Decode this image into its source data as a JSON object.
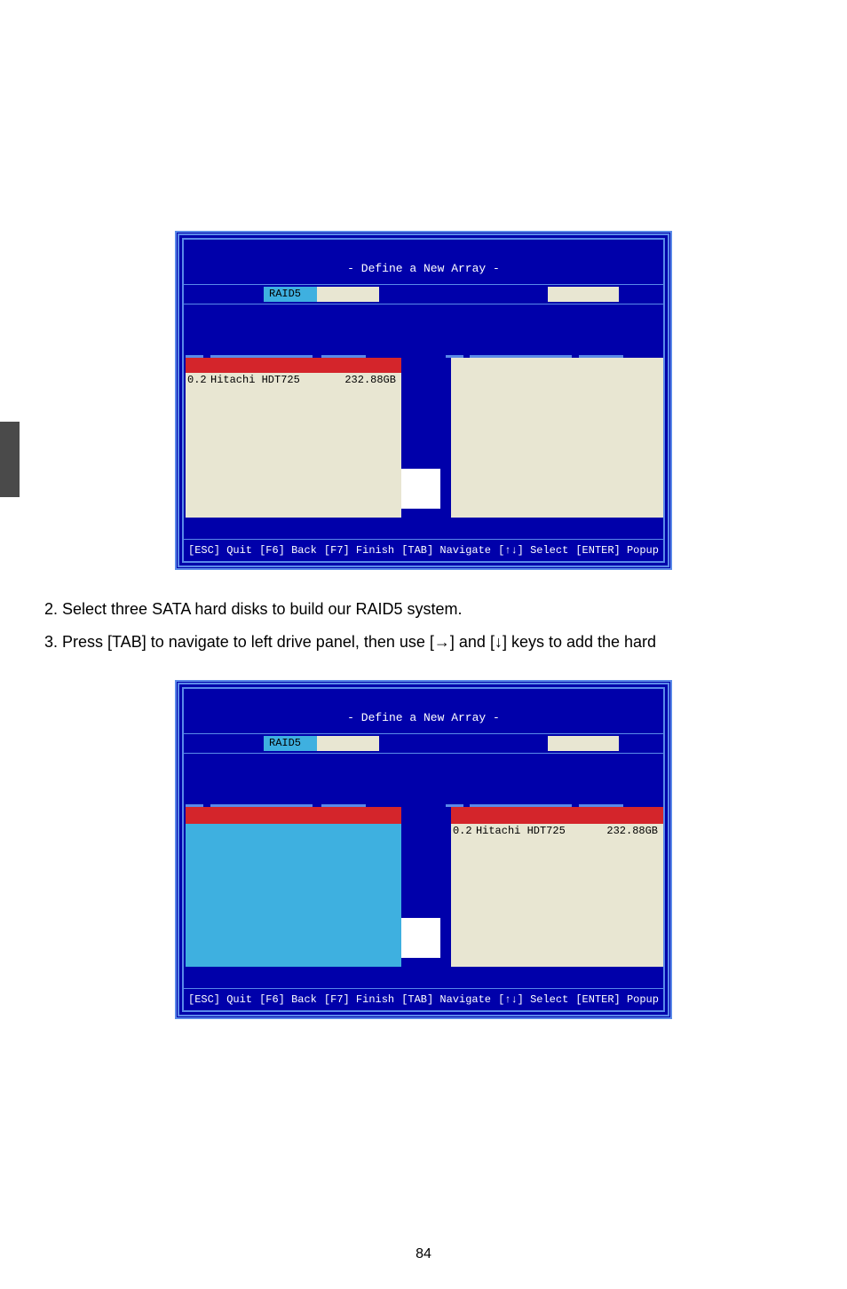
{
  "sideTab": "",
  "screen1": {
    "title": "- Define a New Array -",
    "raidMode": "RAID5",
    "freeDisks": [
      {
        "port": "0.2",
        "model": "Hitachi HDT725",
        "size": "232.88GB"
      }
    ],
    "arrayDisks": [],
    "footer": {
      "quit": "[ESC] Quit",
      "back": "[F6] Back",
      "finish": "[F7] Finish",
      "navigate": "[TAB] Navigate",
      "select": "[↑↓] Select",
      "popup": "[ENTER] Popup"
    }
  },
  "instructions": {
    "step2": "2. Select three SATA hard disks to build our RAID5 system.",
    "step3": "3. Press [TAB] to navigate to left drive panel, then use [→] and [↓] keys to add the hard"
  },
  "screen2": {
    "title": "- Define a New Array -",
    "raidMode": "RAID5",
    "freeDisks": [],
    "arrayDisks": [
      {
        "port": "0.2",
        "model": "Hitachi HDT725",
        "size": "232.88GB"
      }
    ],
    "footer": {
      "quit": "[ESC] Quit",
      "back": "[F6] Back",
      "finish": "[F7] Finish",
      "navigate": "[TAB] Navigate",
      "select": "[↑↓] Select",
      "popup": "[ENTER] Popup"
    }
  },
  "pageNumber": "84"
}
